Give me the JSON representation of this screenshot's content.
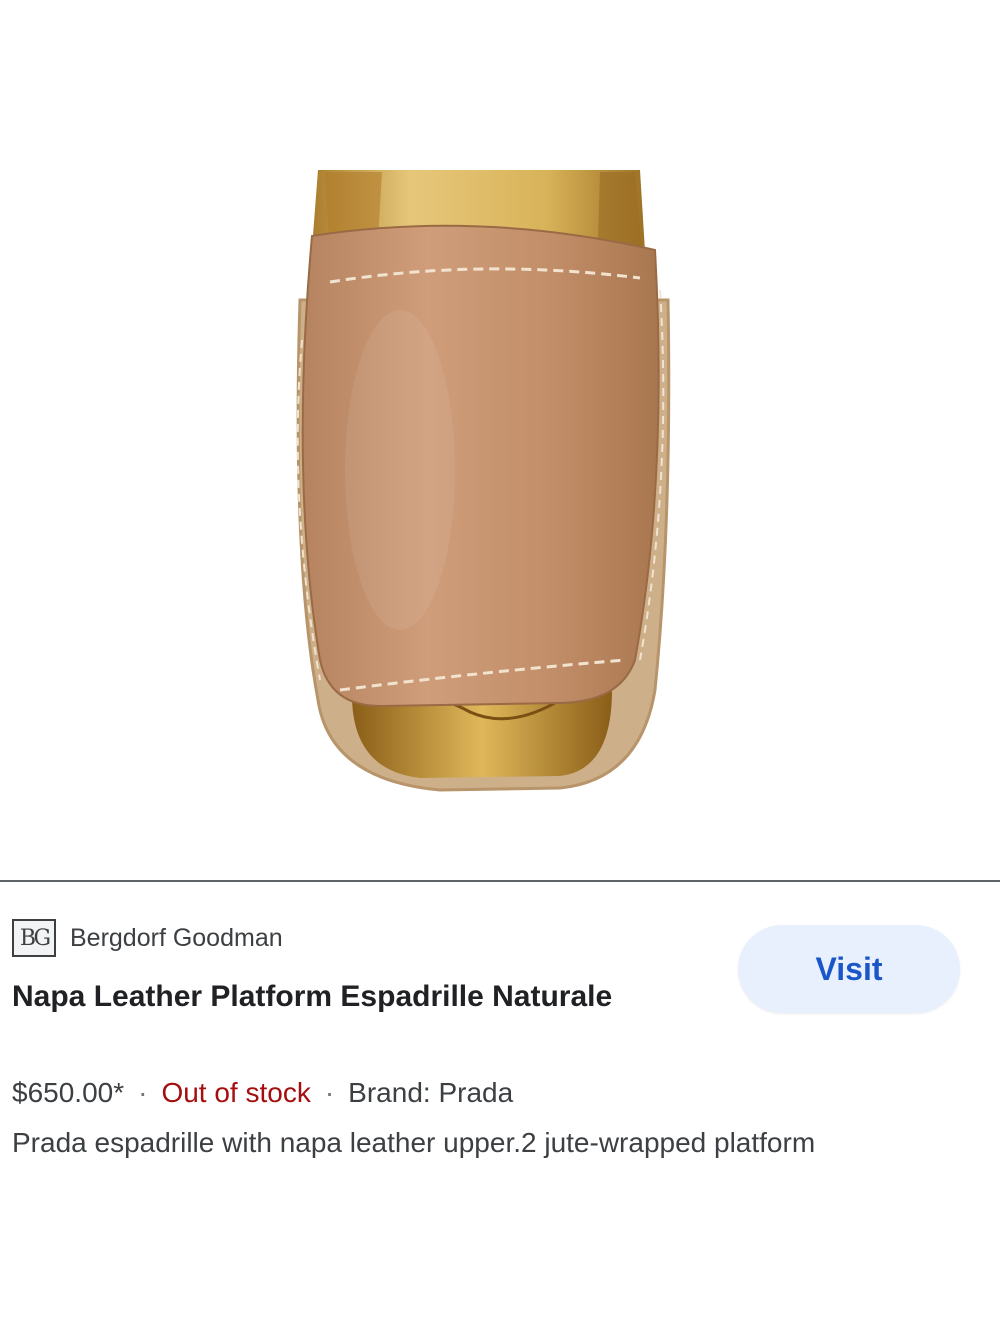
{
  "product_image": {
    "alt_subject": "tan leather espadrille sandal"
  },
  "merchant": {
    "logo_text": "BG",
    "name": "Bergdorf Goodman"
  },
  "product": {
    "title": "Napa Leather Platform Espadrille Naturale",
    "price": "$650.00*",
    "separator": "·",
    "stock_status": "Out of stock",
    "brand": "Brand: Prada",
    "description": "Prada espadrille with napa leather upper.2 jute-wrapped platform"
  },
  "actions": {
    "visit_label": "Visit"
  },
  "colors": {
    "visit_bg": "#e8f0fe",
    "visit_text": "#1a56c8",
    "stock_text": "#a50e0e",
    "leather": "#c4916b",
    "insole": "#d9b35a",
    "jute": "#cdb08a"
  }
}
